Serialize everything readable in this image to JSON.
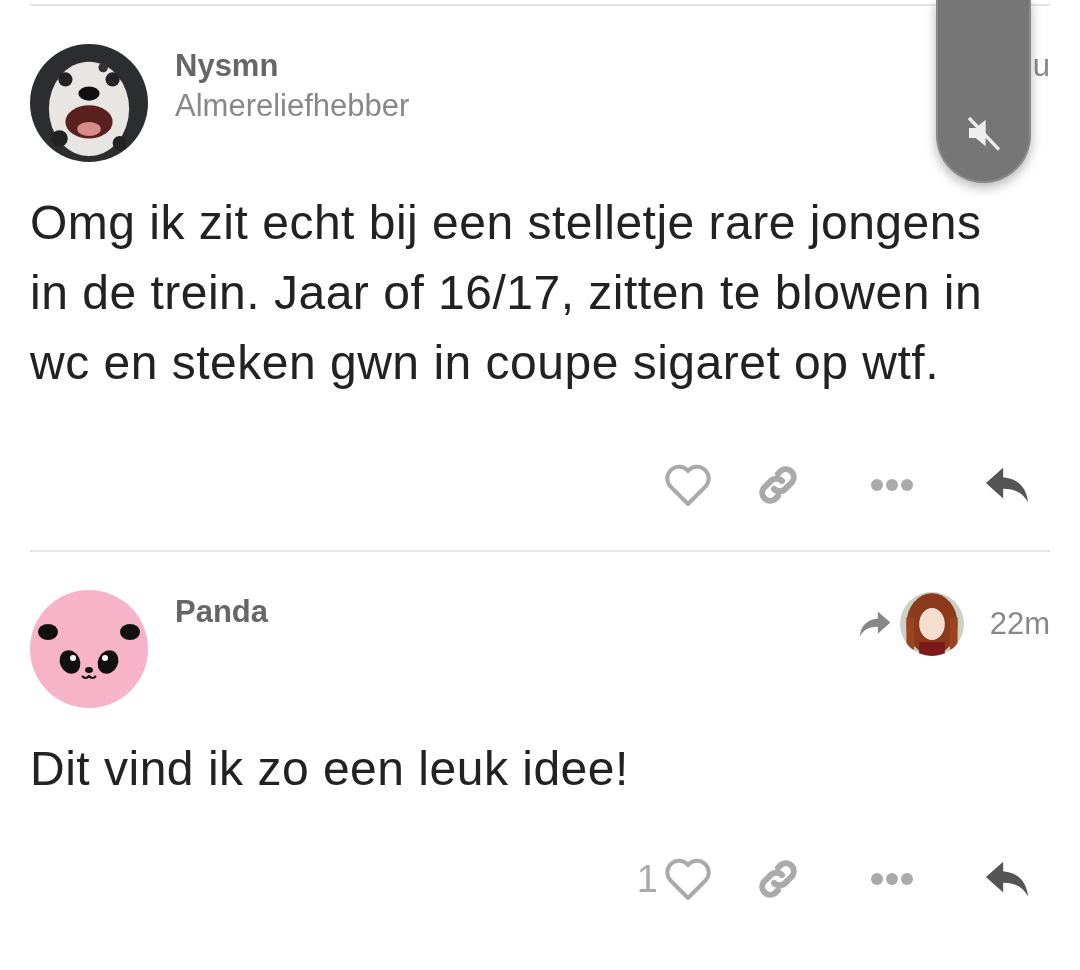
{
  "posts": [
    {
      "author": "Nysmn",
      "subtitle": "Almereliefhebber",
      "time": "u",
      "body": "Omg ik zit echt bij een stelletje rare jongens in de trein. Jaar of 16/17, zitten te blowen in wc en steken gwn in coupe sigaret op wtf.",
      "liked": false
    },
    {
      "author": "Panda",
      "time": "22m",
      "avatar": {
        "kind": "panda"
      },
      "body": "Dit vind ik zo een leuk idee!",
      "likes": "1",
      "liked": false
    }
  ],
  "volume_overlay": {
    "muted": true
  }
}
